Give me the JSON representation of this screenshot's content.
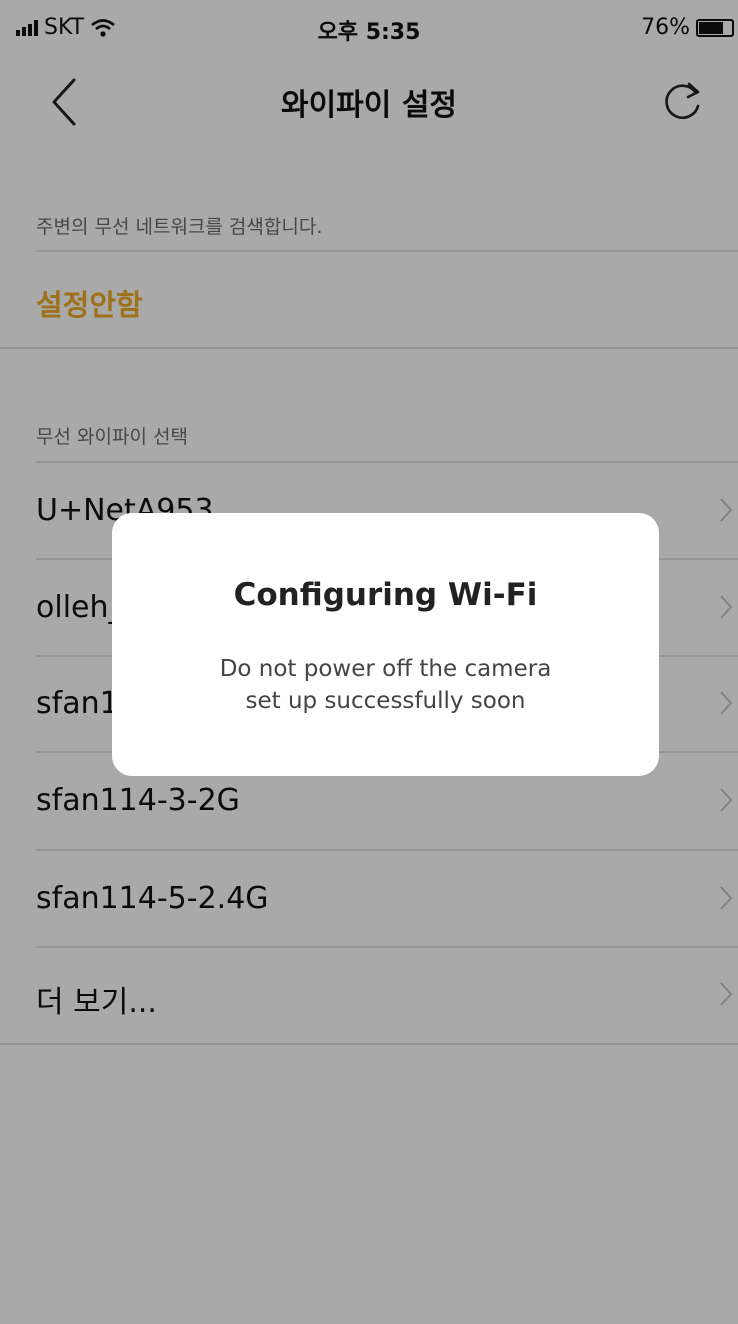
{
  "status": {
    "carrier": "SKT",
    "time": "오후 5:35",
    "battery_text": "76%",
    "battery_level": 0.76
  },
  "nav": {
    "title": "와이파이 설정"
  },
  "section1": {
    "header": "주변의 무선 네트워크를 검색합니다.",
    "none_option": "설정안함"
  },
  "section2": {
    "header": "무선 와이파이 선택",
    "items": [
      {
        "label": "U+NetA953"
      },
      {
        "label": "olleh_"
      },
      {
        "label": "sfan1"
      },
      {
        "label": "sfan114-3-2G"
      },
      {
        "label": "sfan114-5-2.4G"
      },
      {
        "label": "더 보기..."
      }
    ]
  },
  "dialog": {
    "title": "Configuring Wi-Fi",
    "message_line1": "Do not power off the camera",
    "message_line2": "set up successfully soon"
  },
  "colors": {
    "accent": "#e2a227",
    "background": "#f2f2f2",
    "dialog_bg": "#ffffff"
  }
}
